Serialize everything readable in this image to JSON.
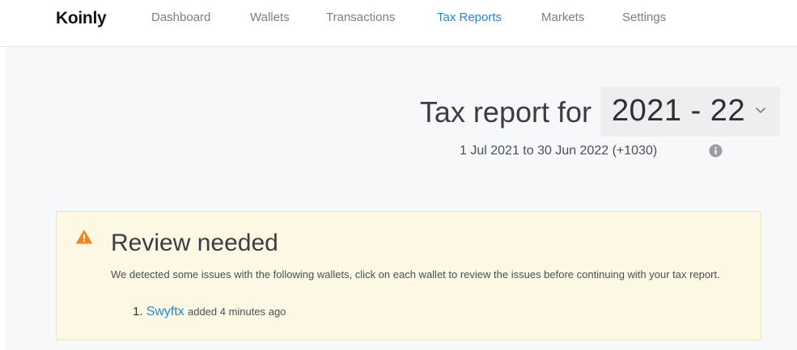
{
  "brand": {
    "logo_text": "Koinly"
  },
  "nav": {
    "items": [
      {
        "label": "Dashboard",
        "active": false
      },
      {
        "label": "Wallets",
        "active": false
      },
      {
        "label": "Transactions",
        "active": false
      },
      {
        "label": "Tax Reports",
        "active": true
      },
      {
        "label": "Markets",
        "active": false
      },
      {
        "label": "Settings",
        "active": false
      }
    ]
  },
  "report": {
    "title_prefix": "Tax report for",
    "selected_year": "2021 - 22",
    "date_range": "1 Jul 2021 to 30 Jun 2022 (+1030)"
  },
  "alert": {
    "title": "Review needed",
    "message": "We detected some issues with the following wallets, click on each wallet to review the issues before continuing with your tax report.",
    "wallets": [
      {
        "index": "1.",
        "name": "Swyftx",
        "meta": "added 4 minutes ago"
      }
    ]
  },
  "icons": {
    "select_caret": "chevron-down-icon",
    "info": "info-icon",
    "alert": "warning-icon"
  },
  "colors": {
    "accent": "#1f8ad8",
    "warning": "#f0861e",
    "alert_background": "#fcf8e3",
    "page_background": "#f7f8f9"
  }
}
